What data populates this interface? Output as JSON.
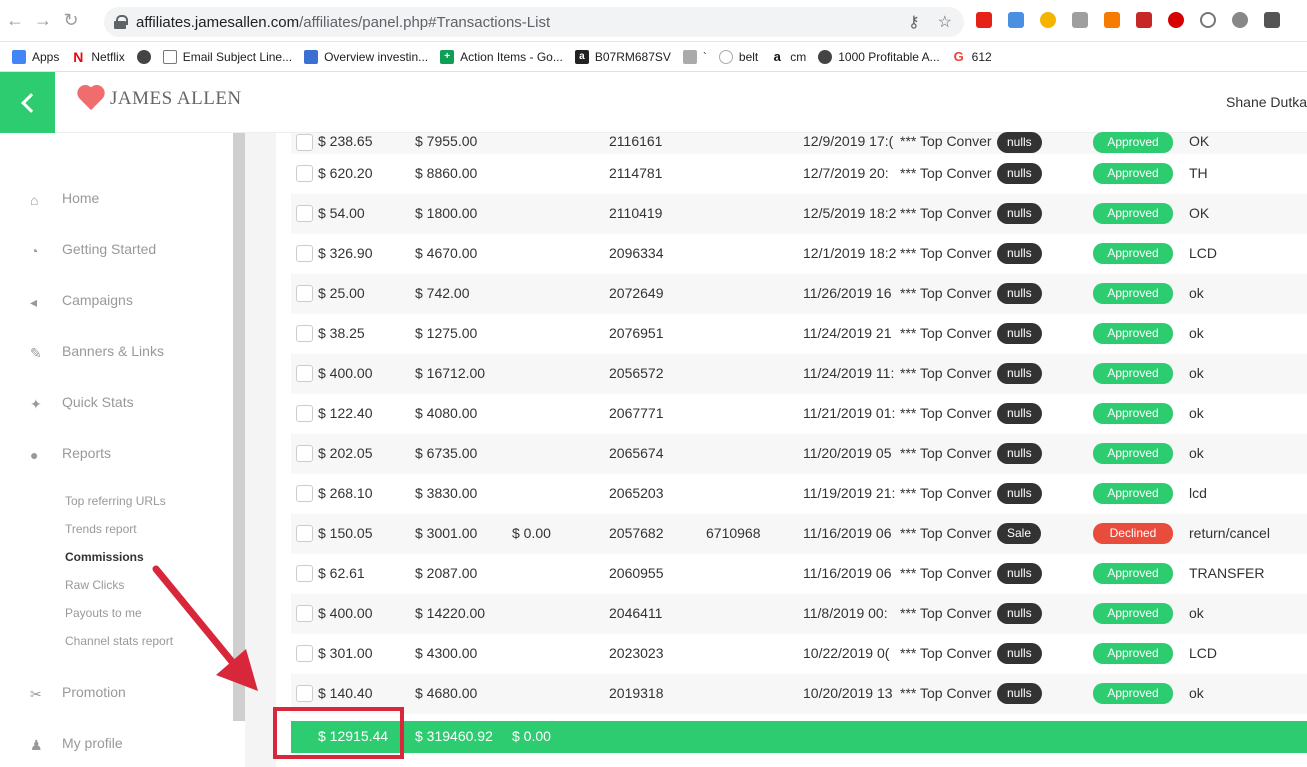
{
  "browser": {
    "url_host": "affiliates.jamesallen.com",
    "url_path": "/affiliates/panel.php#Transactions-List",
    "bookmarks": [
      "Apps",
      "Netflix",
      "",
      "Email Subject Line...",
      "Overview investin...",
      "Action Items - Go...",
      "B07RM687SV",
      "`",
      "belt",
      "cm",
      "1000 Profitable A...",
      "612"
    ]
  },
  "header": {
    "brand": "JAMES ALLEN",
    "user": "Shane Dutka"
  },
  "sidebar": {
    "items": [
      "Home",
      "Getting Started",
      "Campaigns",
      "Banners & Links",
      "Quick Stats",
      "Reports"
    ],
    "reports_sub": [
      "Top referring URLs",
      "Trends report",
      "Commissions",
      "Raw Clicks",
      "Payouts to me",
      "Channel stats report"
    ],
    "bottom_items": [
      "Promotion",
      "My profile"
    ]
  },
  "table": {
    "rows": [
      [
        "$ 238.65",
        "$ 7955.00",
        "",
        "2116161",
        "",
        "12/9/2019 17:(",
        "*** Top Conver",
        "nulls",
        "Approved",
        "OK"
      ],
      [
        "$ 620.20",
        "$ 8860.00",
        "",
        "2114781",
        "",
        "12/7/2019 20:",
        "*** Top Conver",
        "nulls",
        "Approved",
        "TH"
      ],
      [
        "$ 54.00",
        "$ 1800.00",
        "",
        "2110419",
        "",
        "12/5/2019 18:2",
        "*** Top Conver",
        "nulls",
        "Approved",
        "OK"
      ],
      [
        "$ 326.90",
        "$ 4670.00",
        "",
        "2096334",
        "",
        "12/1/2019 18:2",
        "*** Top Conver",
        "nulls",
        "Approved",
        "LCD"
      ],
      [
        "$ 25.00",
        "$ 742.00",
        "",
        "2072649",
        "",
        "11/26/2019 16",
        "*** Top Conver",
        "nulls",
        "Approved",
        "ok"
      ],
      [
        "$ 38.25",
        "$ 1275.00",
        "",
        "2076951",
        "",
        "11/24/2019 21",
        "*** Top Conver",
        "nulls",
        "Approved",
        "ok"
      ],
      [
        "$ 400.00",
        "$ 16712.00",
        "",
        "2056572",
        "",
        "11/24/2019 11:",
        "*** Top Conver",
        "nulls",
        "Approved",
        "ok"
      ],
      [
        "$ 122.40",
        "$ 4080.00",
        "",
        "2067771",
        "",
        "11/21/2019 01:",
        "*** Top Conver",
        "nulls",
        "Approved",
        "ok"
      ],
      [
        "$ 202.05",
        "$ 6735.00",
        "",
        "2065674",
        "",
        "11/20/2019 05",
        "*** Top Conver",
        "nulls",
        "Approved",
        "ok"
      ],
      [
        "$ 268.10",
        "$ 3830.00",
        "",
        "2065203",
        "",
        "11/19/2019 21:",
        "*** Top Conver",
        "nulls",
        "Approved",
        "lcd"
      ],
      [
        "$ 150.05",
        "$ 3001.00",
        "$ 0.00",
        "2057682",
        "6710968",
        "11/16/2019 06",
        "*** Top Conver",
        "Sale",
        "Declined",
        "return/cancel"
      ],
      [
        "$ 62.61",
        "$ 2087.00",
        "",
        "2060955",
        "",
        "11/16/2019 06",
        "*** Top Conver",
        "nulls",
        "Approved",
        "TRANSFER"
      ],
      [
        "$ 400.00",
        "$ 14220.00",
        "",
        "2046411",
        "",
        "11/8/2019 00:",
        "*** Top Conver",
        "nulls",
        "Approved",
        "ok"
      ],
      [
        "$ 301.00",
        "$ 4300.00",
        "",
        "2023023",
        "",
        "10/22/2019 0(",
        "*** Top Conver",
        "nulls",
        "Approved",
        "LCD"
      ],
      [
        "$ 140.40",
        "$ 4680.00",
        "",
        "2019318",
        "",
        "10/20/2019 13",
        "*** Top Conver",
        "nulls",
        "Approved",
        "ok"
      ]
    ],
    "totals": [
      "$ 12915.44",
      "$ 319460.92",
      "$ 0.00"
    ]
  },
  "colors": {
    "green": "#2ecc71",
    "red": "#e74c3c",
    "highlight": "#d8273b"
  }
}
